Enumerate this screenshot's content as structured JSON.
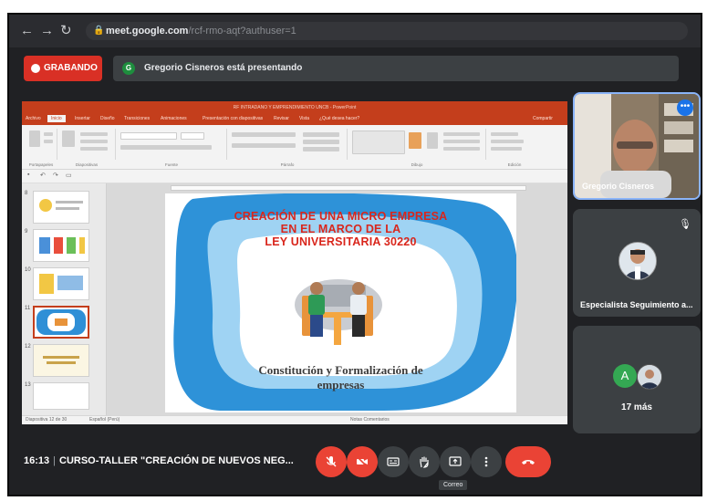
{
  "browser": {
    "url_host": "meet.google.com",
    "url_path": "/rcf-rmo-aqt?authuser=1"
  },
  "recording": {
    "label": "GRABANDO"
  },
  "presenting": {
    "badge": "G",
    "text": "Gregorio Cisneros está presentando"
  },
  "ppt": {
    "title": "RF INTRADANO Y EMPRENDIMIENTO UNCB - PowerPoint",
    "tabs": [
      "Archivo",
      "Inicio",
      "Insertar",
      "Diseño",
      "Transiciones",
      "Animaciones",
      "Presentación con diapositivas",
      "Revisar",
      "Vista",
      "¿Qué desea hacer?",
      "Compartir"
    ],
    "ribbon_groups": [
      "Portapapeles",
      "Diapositivas",
      "Fuente",
      "Párrafo",
      "Dibujo",
      "Edición"
    ],
    "slide_numbers": [
      "8",
      "9",
      "10",
      "11",
      "12",
      "13"
    ],
    "status_left": "Diapositiva 12 de 30",
    "status_lang": "Español (Perú)",
    "status_right": "Notas   Comentarios",
    "slide": {
      "title_line1": "CREACIÓN DE UNA MICRO EMPRESA",
      "title_line2": "EN EL MARCO DE LA",
      "title_line3": "LEY UNIVERSITARIA 30220",
      "subtitle_line1": "Constitución y Formalización de",
      "subtitle_line2": "empresas",
      "title_color": "#d9261c",
      "subtitle_color": "#3b3b3b"
    }
  },
  "participants": [
    {
      "name": "Gregorio Cisneros"
    },
    {
      "name": "Especialista Seguimiento a..."
    },
    {
      "avatar_letter": "A",
      "more": "17 más"
    }
  ],
  "meeting": {
    "time": "16:13",
    "title": "CURSO-TALLER \"CREACIÓN DE NUEVOS NEG..."
  },
  "controls": {
    "tooltip": "Correo",
    "icons": [
      "mic-off-icon",
      "camera-off-icon",
      "captions-icon",
      "raise-hand-icon",
      "present-icon",
      "more-options-icon",
      "end-call-icon"
    ]
  }
}
